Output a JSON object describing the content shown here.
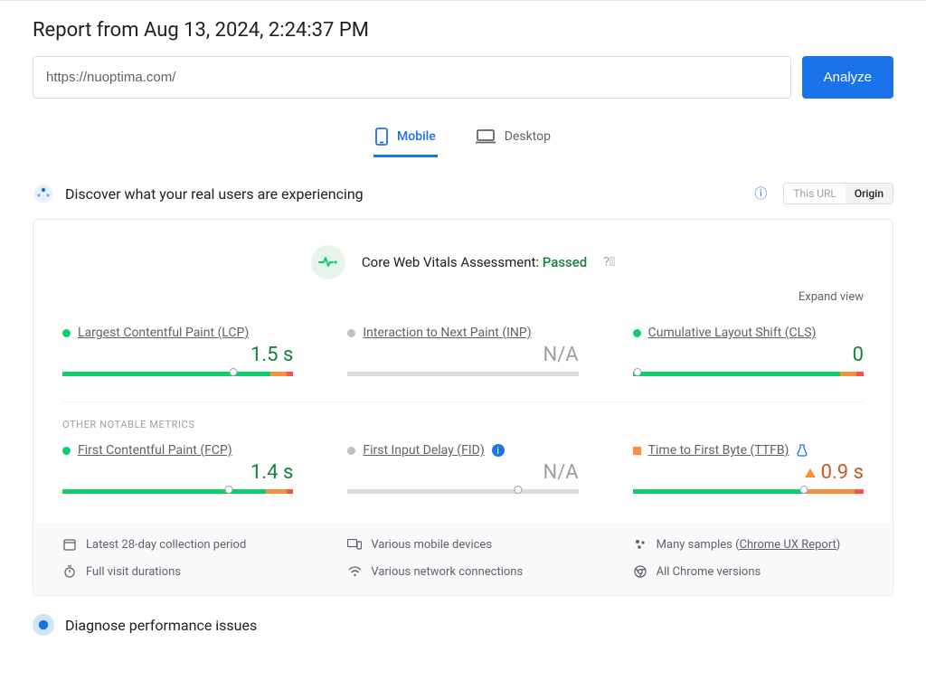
{
  "report_title": "Report from Aug 13, 2024, 2:24:37 PM",
  "url_value": "https://nuoptima.com/",
  "analyze_label": "Analyze",
  "tabs": {
    "mobile": "Mobile",
    "desktop": "Desktop"
  },
  "discover": {
    "title": "Discover what your real users are experiencing",
    "toggle_this_url": "This URL",
    "toggle_origin": "Origin"
  },
  "assessment": {
    "prefix": "Core Web Vitals Assessment: ",
    "status": "Passed"
  },
  "expand_view_label": "Expand view",
  "metrics": {
    "lcp": {
      "name": "Largest Contentful Paint (LCP)",
      "value": "1.5 s"
    },
    "inp": {
      "name": "Interaction to Next Paint (INP)",
      "value": "N/A"
    },
    "cls": {
      "name": "Cumulative Layout Shift (CLS)",
      "value": "0"
    },
    "fcp": {
      "name": "First Contentful Paint (FCP)",
      "value": "1.4 s"
    },
    "fid": {
      "name": "First Input Delay (FID)",
      "value": "N/A"
    },
    "ttfb": {
      "name": "Time to First Byte (TTFB)",
      "value": "0.9 s"
    }
  },
  "other_metrics_label": "OTHER NOTABLE METRICS",
  "footer": {
    "collection": "Latest 28-day collection period",
    "devices": "Various mobile devices",
    "samples_prefix": "Many samples (",
    "samples_link": "Chrome UX Report",
    "samples_suffix": ")",
    "durations": "Full visit durations",
    "network": "Various network connections",
    "versions": "All Chrome versions"
  },
  "diagnose_title": "Diagnose performance issues"
}
